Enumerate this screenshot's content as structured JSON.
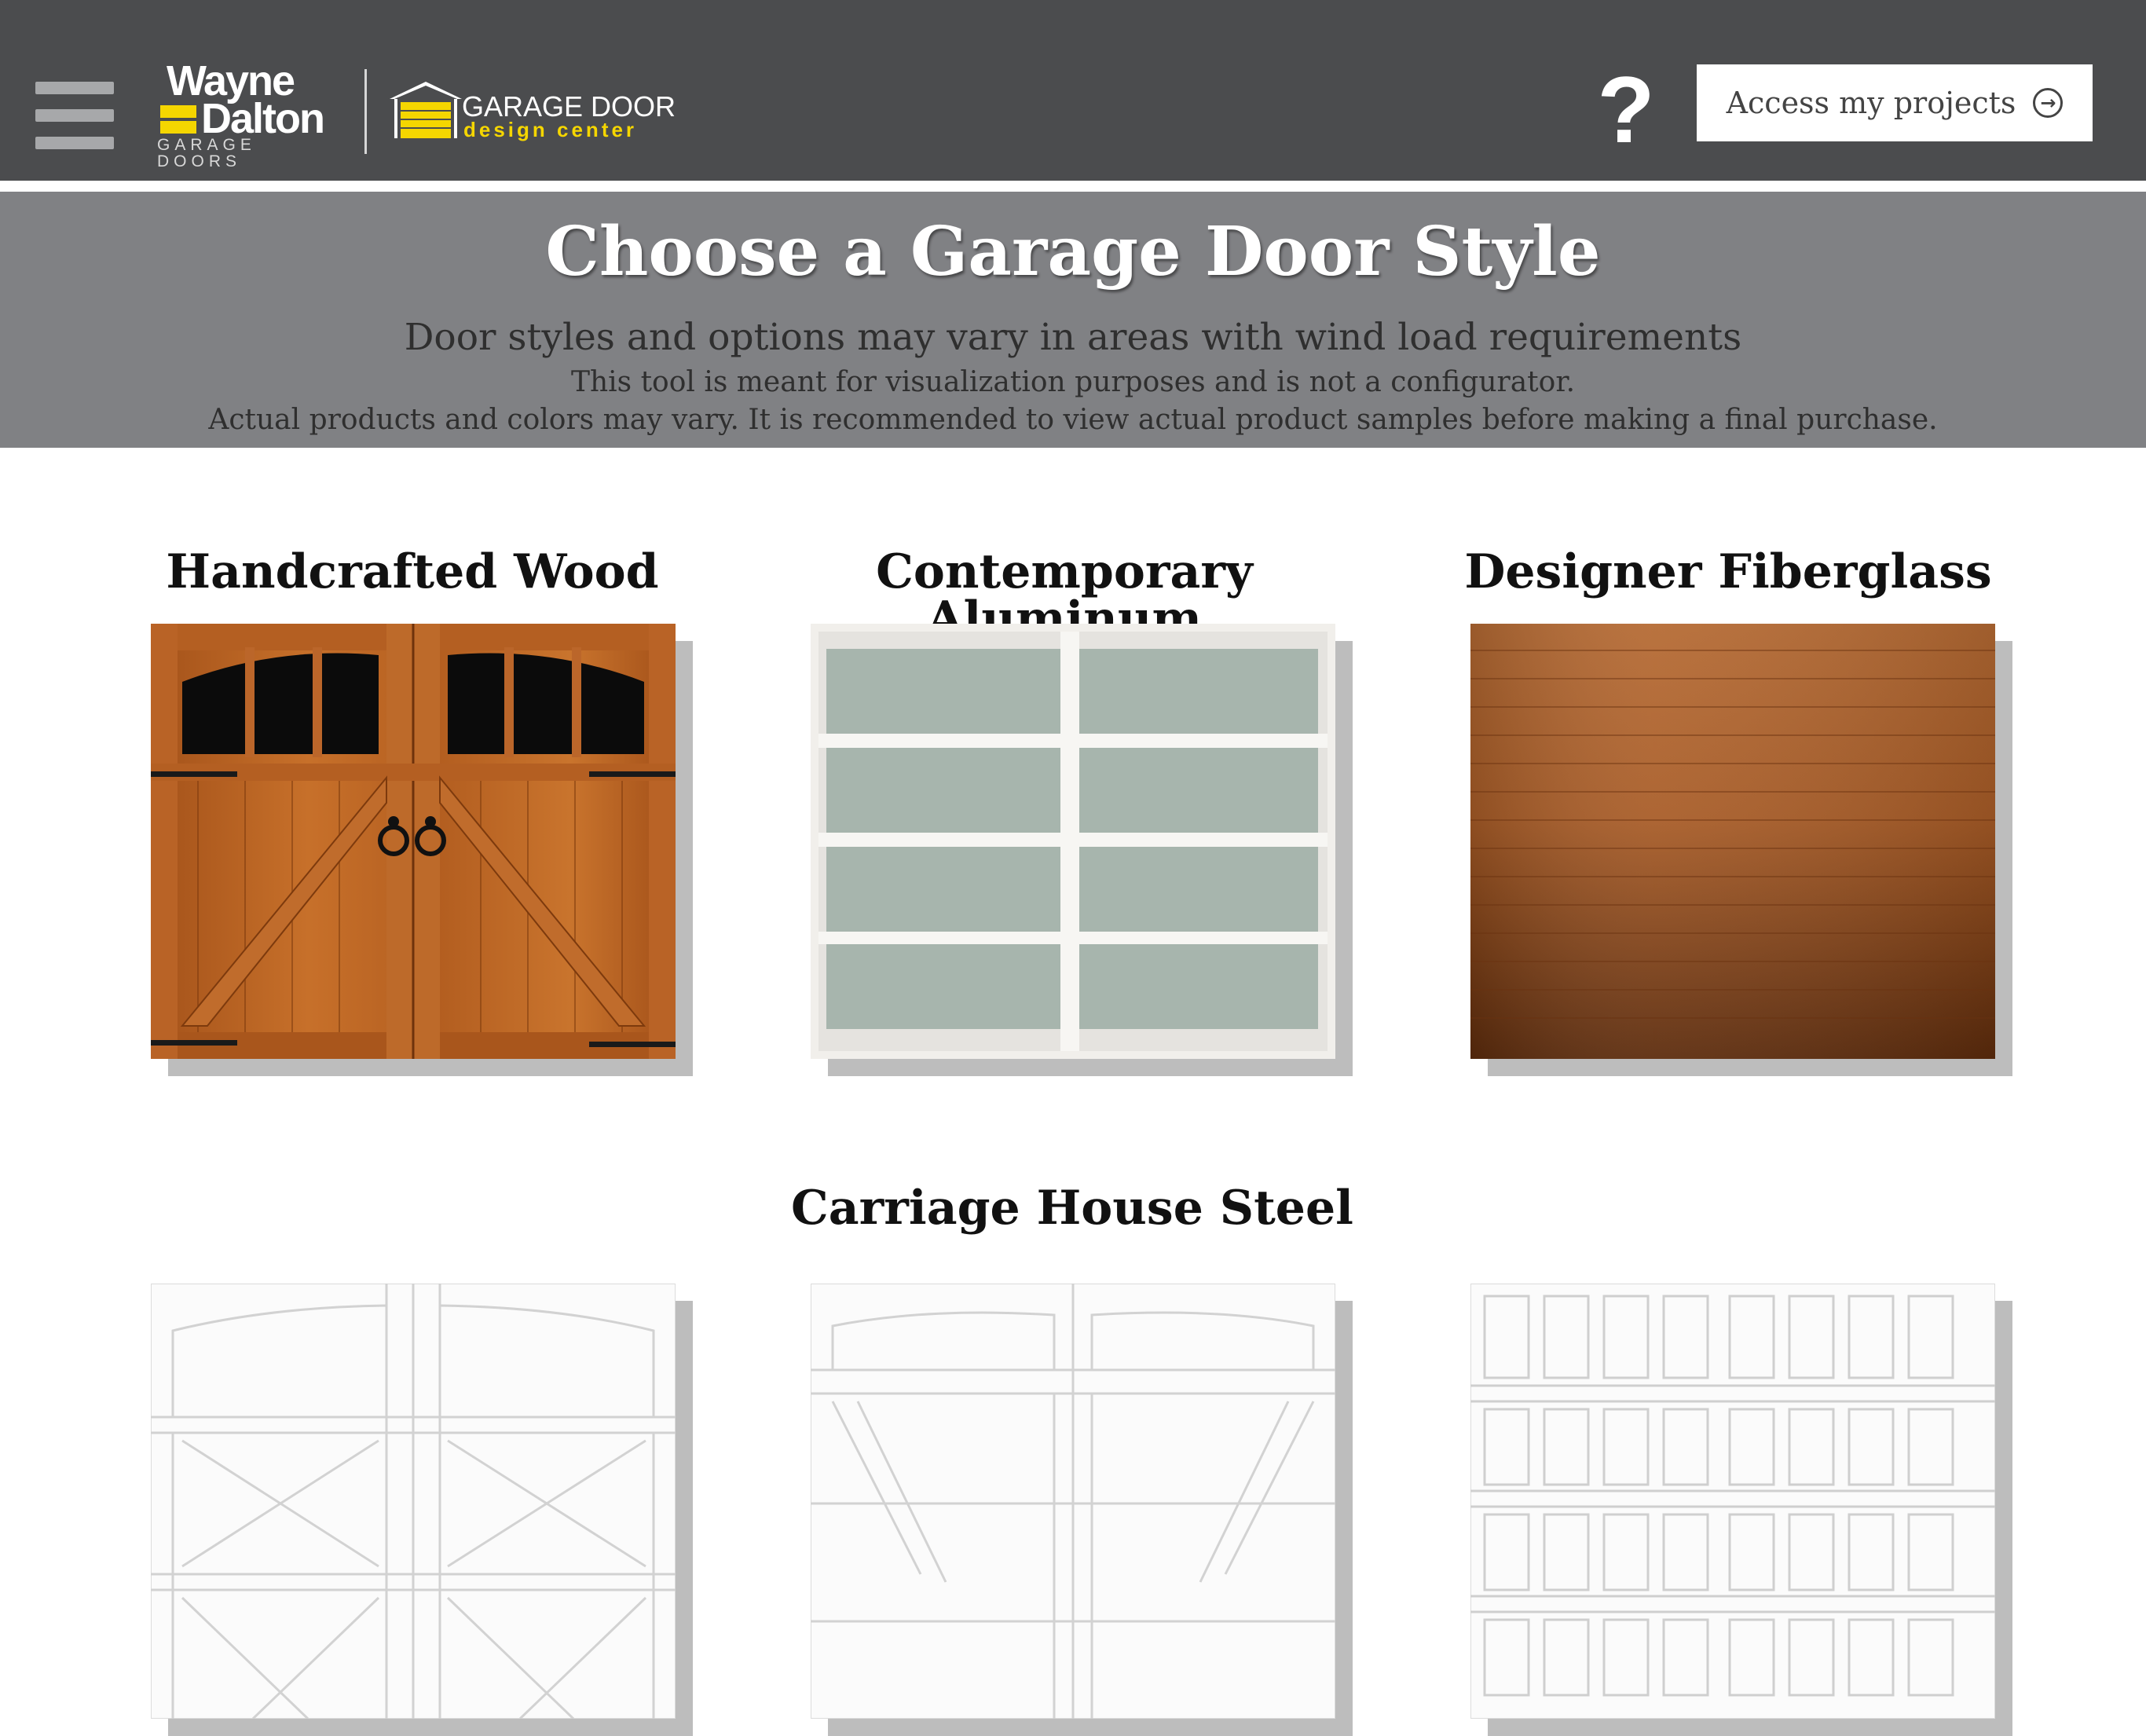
{
  "header": {
    "brand_line1": "Wayne",
    "brand_line2": "Dalton",
    "brand_line3": "GARAGE DOORS",
    "design_center_line1": "GARAGE DOOR",
    "design_center_line2": "design center",
    "help_glyph": "?",
    "access_button_label": "Access my projects",
    "access_button_icon": "arrow-right-circle-icon",
    "menu_icon": "hamburger-menu-icon"
  },
  "banner": {
    "title": "Choose a Garage Door Style",
    "subtitle": "Door styles and options may vary in areas with wind load requirements",
    "note1": "This tool is meant for visualization purposes and is not a configurator.",
    "note2": "Actual products and colors may vary. It is recommended to view actual product samples before making a final purchase."
  },
  "styles": [
    {
      "label": "Handcrafted Wood"
    },
    {
      "label": "Contemporary Aluminum"
    },
    {
      "label": "Designer Fiberglass"
    },
    {
      "label": "Carriage House Steel"
    }
  ],
  "colors": {
    "topbar": "#4b4c4e",
    "banner": "#808184",
    "brand_yellow": "#f5d600"
  }
}
